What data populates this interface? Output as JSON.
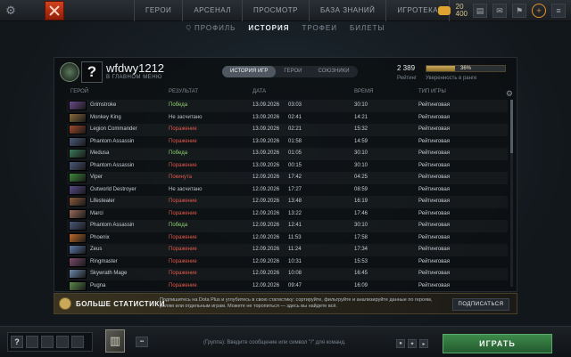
{
  "topbar": {
    "nav": [
      "ГЕРОИ",
      "АРСЕНАЛ",
      "ПРОСМОТР",
      "БАЗА ЗНАНИЙ",
      "ИГРОТЕКА"
    ],
    "tokens_top": "20",
    "tokens_bottom": "400"
  },
  "subnav": {
    "profile": "ПРОФИЛЬ",
    "history": "ИСТОРИЯ",
    "trophies": "ТРОФЕИ",
    "tickets": "БИЛЕТЫ"
  },
  "profile": {
    "avatar_char": "?",
    "username": "wfdwy1212",
    "status": "В ГЛАВНОМ МЕНЮ",
    "tabs": [
      "ИСТОРИЯ ИГР",
      "ГЕРОИ",
      "СОЮЗНИКИ"
    ],
    "rating": "2 389",
    "rating_label": "Рейтинг",
    "confidence": 36,
    "confidence_text": "36%",
    "confidence_label": "Уверенность в ранге"
  },
  "table": {
    "columns": {
      "hero": "ГЕРОЙ",
      "result": "РЕЗУЛЬТАТ",
      "date": "ДАТА",
      "time": "ВРЕМЯ",
      "type": "ТИП ИГРЫ"
    },
    "rows": [
      {
        "hero": "Grimstroke",
        "result": "Победа",
        "kind": "win",
        "date": "13.09.2026",
        "clock": "03:03",
        "duration": "30:10",
        "type": "Рейтинговая",
        "color": "#6a4a8a"
      },
      {
        "hero": "Monkey King",
        "result": "Не засчитано",
        "kind": "nc",
        "date": "13.09.2026",
        "clock": "02:41",
        "duration": "14:21",
        "type": "Рейтинговая",
        "color": "#8a6a3a"
      },
      {
        "hero": "Legion Commander",
        "result": "Поражение",
        "kind": "loss",
        "date": "13.09.2026",
        "clock": "02:21",
        "duration": "15:32",
        "type": "Рейтинговая",
        "color": "#a04a2a"
      },
      {
        "hero": "Phantom Assassin",
        "result": "Поражение",
        "kind": "loss",
        "date": "13.09.2026",
        "clock": "01:58",
        "duration": "14:59",
        "type": "Рейтинговая",
        "color": "#4a5a7a"
      },
      {
        "hero": "Medusa",
        "result": "Победа",
        "kind": "win",
        "date": "13.09.2026",
        "clock": "01:05",
        "duration": "30:10",
        "type": "Рейтинговая",
        "color": "#3a7a5a"
      },
      {
        "hero": "Phantom Assassin",
        "result": "Поражение",
        "kind": "loss",
        "date": "13.09.2026",
        "clock": "00:15",
        "duration": "30:10",
        "type": "Рейтинговая",
        "color": "#4a5a7a"
      },
      {
        "hero": "Viper",
        "result": "Покинута",
        "kind": "abandon",
        "date": "12.09.2026",
        "clock": "17:42",
        "duration": "04:25",
        "type": "Рейтинговая",
        "color": "#3a8a3a"
      },
      {
        "hero": "Outworld Destroyer",
        "result": "Не засчитано",
        "kind": "nc",
        "date": "12.09.2026",
        "clock": "17:27",
        "duration": "08:59",
        "type": "Рейтинговая",
        "color": "#5a4a8a"
      },
      {
        "hero": "Lifestealer",
        "result": "Поражение",
        "kind": "loss",
        "date": "12.09.2026",
        "clock": "13:48",
        "duration": "16:19",
        "type": "Рейтинговая",
        "color": "#8a5a3a"
      },
      {
        "hero": "Marci",
        "result": "Поражение",
        "kind": "loss",
        "date": "12.09.2026",
        "clock": "13:22",
        "duration": "17:46",
        "type": "Рейтинговая",
        "color": "#9a6a5a"
      },
      {
        "hero": "Phantom Assassin",
        "result": "Победа",
        "kind": "win",
        "date": "12.09.2026",
        "clock": "12:41",
        "duration": "30:10",
        "type": "Рейтинговая",
        "color": "#4a5a7a"
      },
      {
        "hero": "Phoenix",
        "result": "Поражение",
        "kind": "loss",
        "date": "12.09.2026",
        "clock": "11:53",
        "duration": "17:58",
        "type": "Рейтинговая",
        "color": "#c06a2a"
      },
      {
        "hero": "Zeus",
        "result": "Поражение",
        "kind": "loss",
        "date": "12.09.2026",
        "clock": "11:24",
        "duration": "17:34",
        "type": "Рейтинговая",
        "color": "#5a7aaa"
      },
      {
        "hero": "Ringmaster",
        "result": "Поражение",
        "kind": "loss",
        "date": "12.09.2026",
        "clock": "10:31",
        "duration": "15:53",
        "type": "Рейтинговая",
        "color": "#7a4a6a"
      },
      {
        "hero": "Skywrath Mage",
        "result": "Поражение",
        "kind": "loss",
        "date": "12.09.2026",
        "clock": "10:08",
        "duration": "16:45",
        "type": "Рейтинговая",
        "color": "#6a8aaa"
      },
      {
        "hero": "Pugna",
        "result": "Поражение",
        "kind": "loss",
        "date": "12.09.2026",
        "clock": "09:47",
        "duration": "16:09",
        "type": "Рейтинговая",
        "color": "#5a8a4a"
      }
    ]
  },
  "promo": {
    "title": "БОЛЬШЕ СТАТИСТИКИ",
    "text": "Подпишитесь на Dota Plus и углубитесь в свою статистику: сортируйте, фильтруйте и анализируйте данные по героям, ролям или отдельным играм. Можете не торопиться — здесь вы найдете всё.",
    "button": "ПОДПИСАТЬСЯ"
  },
  "bottombar": {
    "party_slot": "?",
    "chat_placeholder": "(Группа): Введите сообщение или символ \"/\" для команд.",
    "play": "ИГРАТЬ"
  }
}
